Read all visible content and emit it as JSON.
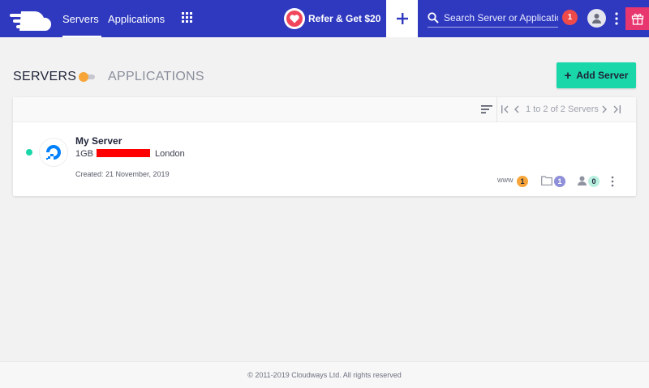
{
  "nav": {
    "logo": "cloud-logo",
    "tabs": [
      {
        "label": "Servers",
        "active": true
      },
      {
        "label": "Applications",
        "active": false
      }
    ],
    "refer_label": "Refer & Get $20",
    "search_placeholder": "Search Server or Application",
    "notification_count": "1"
  },
  "page": {
    "title": "SERVERS",
    "toggle_label": "APPLICATIONS",
    "add_button": "Add Server"
  },
  "pagination": {
    "info": "1 to 2 of 2 Servers"
  },
  "servers": [
    {
      "name": "My Server",
      "size": "1GB",
      "location": "London",
      "created": "Created: 21 November, 2019",
      "www_label": "www",
      "apps_count": "1",
      "projects_count": "1",
      "users_count": "0",
      "status": "running"
    }
  ],
  "footer": {
    "copyright": "© 2011-2019 Cloudways Ltd. All rights reserved"
  },
  "colors": {
    "topbar": "#2f39bf",
    "accent": "#19d7a9",
    "orange": "#f7a539",
    "gift": "#e8366f",
    "heart": "#f0455a"
  }
}
